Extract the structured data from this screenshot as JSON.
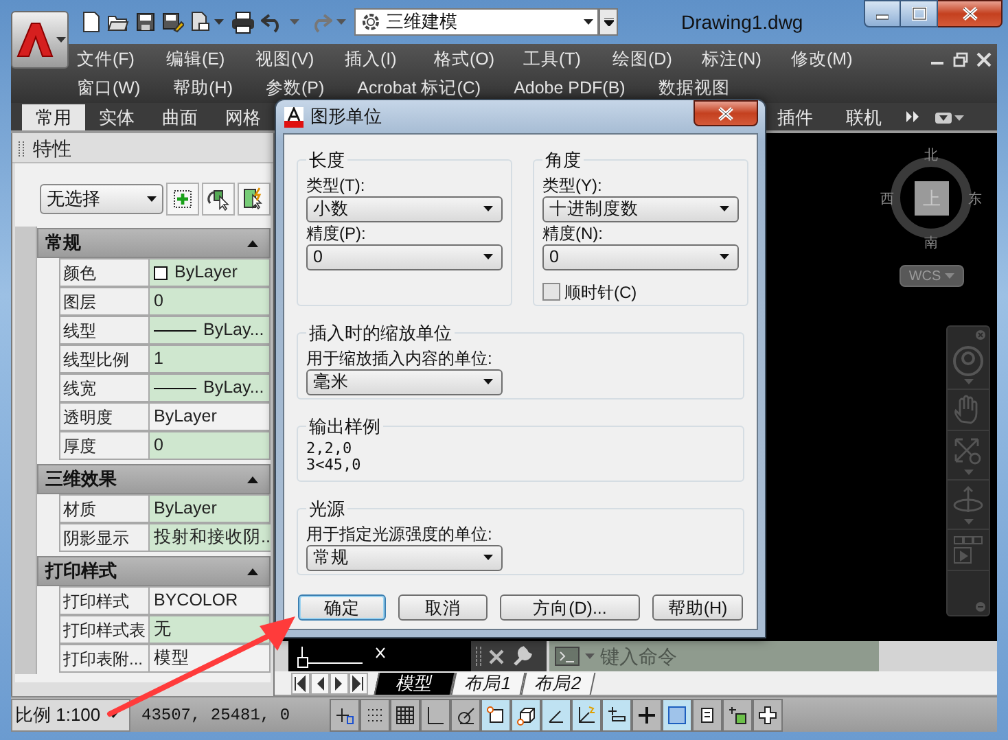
{
  "title_bar": {
    "workspace": "三维建模",
    "title": "Drawing1.dwg"
  },
  "menu_rows": [
    [
      "文件(F)",
      "编辑(E)",
      "视图(V)",
      "插入(I)",
      "格式(O)",
      "工具(T)",
      "绘图(D)",
      "标注(N)",
      "修改(M)"
    ],
    [
      "窗口(W)",
      "帮助(H)",
      "参数(P)",
      "Acrobat 标记(C)",
      "Adobe PDF(B)",
      "数据视图"
    ]
  ],
  "ribbon_tabs": [
    {
      "label": "常用",
      "selected": true
    },
    {
      "label": "实体",
      "selected": false
    },
    {
      "label": "曲面",
      "selected": false
    },
    {
      "label": "网格",
      "selected": false
    }
  ],
  "ribbon_tabs_right": [
    {
      "label": "插件",
      "selected": false
    },
    {
      "label": "联机",
      "selected": false
    }
  ],
  "properties": {
    "title": "特性",
    "selection": "无选择",
    "sections": [
      {
        "title": "常规",
        "expanded": true,
        "rows": [
          {
            "name": "颜色",
            "value": "ByLayer",
            "kind": "color",
            "highlighted": true
          },
          {
            "name": "图层",
            "value": "0",
            "kind": "text",
            "highlighted": true
          },
          {
            "name": "线型",
            "value": "ByLay...",
            "kind": "line",
            "highlighted": true
          },
          {
            "name": "线型比例",
            "value": "1",
            "kind": "text",
            "highlighted": true
          },
          {
            "name": "线宽",
            "value": "ByLay...",
            "kind": "line",
            "highlighted": true
          },
          {
            "name": "透明度",
            "value": "ByLayer",
            "kind": "text",
            "highlighted": false
          },
          {
            "name": "厚度",
            "value": "0",
            "kind": "text",
            "highlighted": true
          }
        ]
      },
      {
        "title": "三维效果",
        "expanded": true,
        "rows": [
          {
            "name": "材质",
            "value": "ByLayer",
            "kind": "text",
            "highlighted": true
          },
          {
            "name": "阴影显示",
            "value": "投射和接收阴...",
            "kind": "text",
            "highlighted": true
          }
        ]
      },
      {
        "title": "打印样式",
        "expanded": true,
        "rows": [
          {
            "name": "打印样式",
            "value": "BYCOLOR",
            "kind": "text",
            "highlighted": false
          },
          {
            "name": "打印样式表",
            "value": "无",
            "kind": "text",
            "highlighted": true
          },
          {
            "name": "打印表附...",
            "value": "模型",
            "kind": "text",
            "highlighted": false
          }
        ]
      }
    ]
  },
  "viewcube": {
    "north": "北",
    "south": "南",
    "west": "西",
    "east": "东",
    "face": "上",
    "ucs": "WCS"
  },
  "command_line": {
    "placeholder": "键入命令"
  },
  "layout_tabs": [
    {
      "label": "模型",
      "selected": true
    },
    {
      "label": "布局1",
      "selected": false
    },
    {
      "label": "布局2",
      "selected": false
    }
  ],
  "status_bar": {
    "scale": "比例 1:100",
    "coordinates": "43507, 25481, 0",
    "toggles": [
      {
        "kind": "track",
        "on": false
      },
      {
        "kind": "snap",
        "on": false
      },
      {
        "kind": "grid",
        "on": false
      },
      {
        "kind": "ortho",
        "on": false
      },
      {
        "kind": "polar",
        "on": false
      },
      {
        "kind": "osnap3d",
        "on": true
      },
      {
        "kind": "cube",
        "on": true
      },
      {
        "kind": "angle",
        "on": true
      },
      {
        "kind": "ducs",
        "on": true
      },
      {
        "kind": "lwt",
        "on": true
      },
      {
        "kind": "cross",
        "on": false
      },
      {
        "kind": "transparency",
        "on": true
      },
      {
        "kind": "qp",
        "on": false
      },
      {
        "kind": "cycle",
        "on": false
      },
      {
        "kind": "plus",
        "on": false
      }
    ]
  },
  "dialog": {
    "title": "图形单位",
    "length": {
      "title": "长度",
      "type_label": "类型(T):",
      "type_value": "小数",
      "precision_label": "精度(P):",
      "precision_value": "0"
    },
    "angle": {
      "title": "角度",
      "type_label": "类型(Y):",
      "type_value": "十进制度数",
      "precision_label": "精度(N):",
      "precision_value": "0",
      "clockwise": {
        "label": "顺时针(C)",
        "checked": false
      }
    },
    "insertion": {
      "title": "插入时的缩放单位",
      "label": "用于缩放插入内容的单位:",
      "value": "毫米"
    },
    "sample": {
      "title": "输出样例",
      "lines": [
        "2,2,0",
        "3<45,0"
      ]
    },
    "lighting": {
      "title": "光源",
      "label": "用于指定光源强度的单位:",
      "value": "常规"
    },
    "buttons": [
      {
        "label": "确定",
        "default": true
      },
      {
        "label": "取消",
        "default": false
      },
      {
        "label": "方向(D)...",
        "default": false
      },
      {
        "label": "帮助(H)",
        "default": false
      }
    ]
  }
}
